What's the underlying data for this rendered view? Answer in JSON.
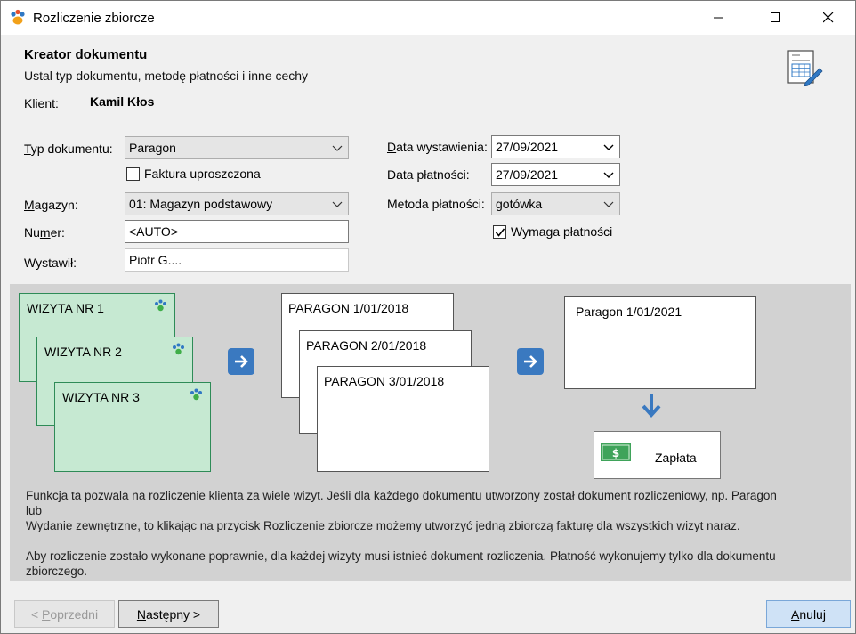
{
  "window": {
    "title": "Rozliczenie zbiorcze"
  },
  "header": {
    "title": "Kreator dokumentu",
    "subtitle": "Ustal typ dokumentu, metodę płatności i inne cechy"
  },
  "client": {
    "label": "Klient:",
    "value": "Kamil Kłos"
  },
  "form": {
    "doc_type_label_pre": "T",
    "doc_type_label_post": "yp dokumentu:",
    "doc_type_value": "Paragon",
    "simplified_invoice_label": "Faktura uproszczona",
    "warehouse_label_pre": "M",
    "warehouse_label_post": "agazyn:",
    "warehouse_value": "01: Magazyn podstawowy",
    "number_label_pre": "Nu",
    "number_label_mid": "m",
    "number_label_post": "er:",
    "number_value": "<AUTO>",
    "issuer_label": "Wystawił:",
    "issuer_value": "Piotr G....",
    "issue_date_label_pre": "D",
    "issue_date_label_post": "ata wystawienia:",
    "issue_date_value": "27/09/2021",
    "payment_date_label": "Data płatności:",
    "payment_date_value": "27/09/2021",
    "payment_method_label": "Metoda płatności:",
    "payment_method_value": "gotówka",
    "requires_payment_label": "Wymaga płatności"
  },
  "diagram": {
    "visits": [
      "WIZYTA NR 1",
      "WIZYTA NR 2",
      "WIZYTA NR 3"
    ],
    "receipts": [
      "PARAGON 1/01/2018",
      "PARAGON 2/01/2018",
      "PARAGON 3/01/2018"
    ],
    "result": "Paragon 1/01/2021",
    "payment": "Zapłata",
    "desc1_line1": "Funkcja ta pozwala na rozliczenie klienta za wiele wizyt. Jeśli dla każdego dokumentu utworzony został dokument rozliczeniowy,  np. Paragon",
    "desc1_line2": "lub",
    "desc1_line3": "Wydanie zewnętrzne, to klikając na przycisk Rozliczenie zbiorcze możemy utworzyć jedną zbiorczą fakturę dla wszystkich wizyt naraz.",
    "desc2_line1": "Aby rozliczenie zostało wykonane poprawnie, dla każdej wizyty musi istnieć dokument rozliczenia. Płatność wykonujemy tylko dla dokumentu",
    "desc2_line2": "zbiorczego."
  },
  "buttons": {
    "prev_pre": "< ",
    "prev_u": "P",
    "prev_post": "oprzedni",
    "next_u": "N",
    "next_post": "astępny >",
    "cancel_u": "A",
    "cancel_post": "nuluj"
  },
  "colors": {
    "visit_fill": "#c6e9d2",
    "arrow": "#3a79c0"
  }
}
